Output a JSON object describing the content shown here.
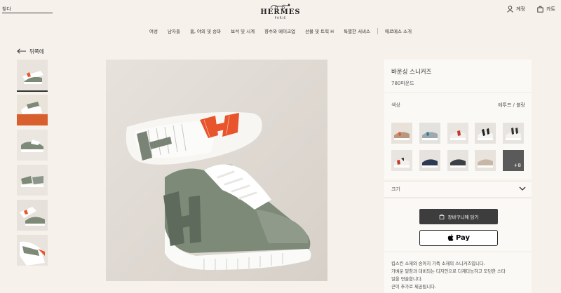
{
  "header": {
    "search_placeholder": "찾다",
    "brand": "HERMES",
    "brand_city": "PARIS",
    "account_label": "계정",
    "cart_label": "카트"
  },
  "nav": {
    "items": [
      "여성",
      "남자들",
      "홈, 야외 및 승마",
      "보석 및 시계",
      "향수와 메이크업",
      "선물 및 트릭 H",
      "특별한 서비스",
      "에르메스 소개"
    ]
  },
  "back_label": "뒤쪽에",
  "product": {
    "title": "바운싱 스니커즈",
    "price": "780파운드",
    "color_label": "색상",
    "color_value": "에투프 / 블랑",
    "more_swatches": "+8",
    "size_label": "크기",
    "add_to_cart": "장바구니에 담기",
    "apple_pay": "Pay",
    "description": [
      "킵스킨 소재와 송아지 가죽 소재의 스니커즈입니다.",
      "가벼운 밑창과 대비되는 디자인으로 다재다능하고 모던한 스타",
      "일을 연출합니다.",
      "끈이 추가로 제공됩니다."
    ]
  },
  "icons": {
    "account": "user-icon",
    "cart": "bag-icon",
    "back": "arrow-left-icon",
    "size": "chevron-down-icon",
    "apple": "apple-logo-icon",
    "add_to_cart": "bag-icon"
  },
  "colors": {
    "background": "#f6f1eb",
    "panel": "#fbf9f6",
    "button_dark": "#3d3d3d",
    "accent_orange": "#e8542c",
    "shoe_green": "#7d8a78"
  }
}
